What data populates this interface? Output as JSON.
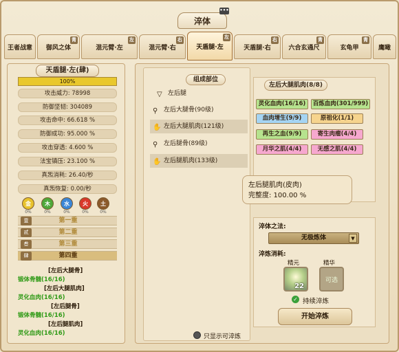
{
  "window": {
    "title": "淬体"
  },
  "tabs": [
    {
      "label": "王者战意",
      "mark": ""
    },
    {
      "label": "御风之体",
      "mark": "青"
    },
    {
      "label": "混元臂·左",
      "mark": "左"
    },
    {
      "label": "混元臂·右",
      "mark": "右"
    },
    {
      "label": "天盾腿·左",
      "mark": "左"
    },
    {
      "label": "天盾腿·右",
      "mark": "右"
    },
    {
      "label": "六合玄通尺",
      "mark": "青"
    },
    {
      "label": "玄龟甲",
      "mark": "青"
    },
    {
      "label": "鹰瞰",
      "mark": ""
    }
  ],
  "left": {
    "title": "天盾腿·左(肆)",
    "progress": "100%",
    "progress_value": 1.0,
    "stats": [
      "攻击威力: 78998",
      "防御坚韧: 304089",
      "攻击命中: 66.618 %",
      "防御成功: 95.000 %",
      "攻击穿透: 4.600 %",
      "法宝镇压: 23.100 %",
      "真炁消耗: 26.40/秒",
      "真炁恢复: 0.00/秒"
    ],
    "elements": [
      {
        "char": "金",
        "pct": "0%",
        "color": "#e8c22c"
      },
      {
        "char": "木",
        "pct": "0%",
        "color": "#4fa83a"
      },
      {
        "char": "水",
        "pct": "0%",
        "color": "#3b86d6"
      },
      {
        "char": "火",
        "pct": "0%",
        "color": "#d9382a"
      },
      {
        "char": "土",
        "pct": "0%",
        "color": "#8b5a2b"
      }
    ],
    "layers": [
      {
        "badge": "壹",
        "label": "第一重"
      },
      {
        "badge": "贰",
        "label": "第二重"
      },
      {
        "badge": "叁",
        "label": "第三重"
      },
      {
        "badge": "肆",
        "label": "第四重"
      }
    ],
    "log": [
      {
        "text": "[左后大腿骨]",
        "color": "w"
      },
      {
        "text": "锻体骨髓(16/16)",
        "color": "g"
      },
      {
        "text": "[左后大腿肌肉]",
        "color": "w"
      },
      {
        "text": "灵化血肉(16/16)",
        "color": "g"
      },
      {
        "text": "[左后腿骨]",
        "color": "w"
      },
      {
        "text": "锻体骨髓(16/16)",
        "color": "g"
      },
      {
        "text": "[左后腿肌肉]",
        "color": "w"
      },
      {
        "text": "灵化血肉(16/16)",
        "color": "g"
      }
    ]
  },
  "parts": {
    "title": "组成部位",
    "items": [
      {
        "icon": "▽",
        "label": "左后腿"
      },
      {
        "icon": "⚲",
        "label": "左后大腿骨(90级)"
      },
      {
        "icon": "✋",
        "label": "左后大腿肌肉(121级)"
      },
      {
        "icon": "⚲",
        "label": "左后腿骨(89级)"
      },
      {
        "icon": "✋",
        "label": "左后腿肌肉(133级)"
      }
    ]
  },
  "detail": {
    "title": "左后大腿肌肉(8/8)",
    "chips": [
      {
        "label": "灵化血肉(16/16)",
        "color": "gr"
      },
      {
        "label": "百炼血肉(301/999)",
        "color": "gr"
      },
      {
        "label": "血肉增生(9/9)",
        "color": "bl"
      },
      {
        "label": "原祖化(1/1)",
        "color": "or"
      },
      {
        "label": "再生之血(9/9)",
        "color": "gr"
      },
      {
        "label": "寄生肉瘤(4/4)",
        "color": "pk"
      },
      {
        "label": "月华之肌(4/4)",
        "color": "pk"
      },
      {
        "label": "无感之肌(4/4)",
        "color": "pk"
      }
    ]
  },
  "info": {
    "line1": "左后腿肌肉(皮肉)",
    "line2": "完整度: 100.00 %"
  },
  "method": {
    "label": "淬体之法:",
    "selected": "无极炼体",
    "cost_label": "淬炼消耗:",
    "slot1_label": "精元",
    "slot1_count": "22",
    "slot2_label": "精华",
    "slot2_text": "可选",
    "continue_label": "持续淬炼",
    "start_label": "开始淬炼"
  },
  "footer": {
    "option": "只显示可淬炼"
  }
}
